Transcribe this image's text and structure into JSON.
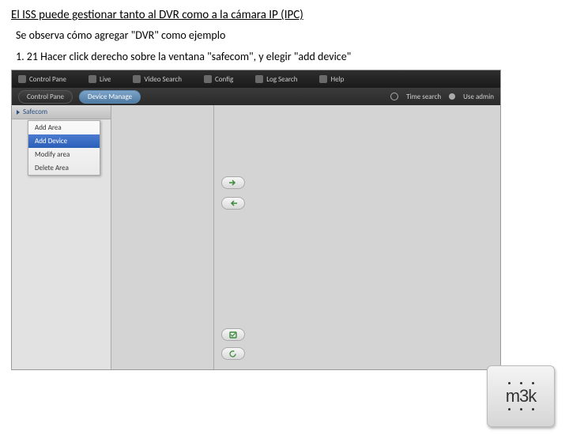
{
  "doc": {
    "title": "El ISS puede gestionar tanto al DVR como a la cámara IP (IPC)",
    "sub": "Se observa cómo agregar \"DVR\" como ejemplo",
    "step": "1. 21 Hacer click derecho sobre la ventana \"safecom\", y elegir \"add device\""
  },
  "menubar": {
    "items": [
      {
        "label": "Control Pane"
      },
      {
        "label": "Live"
      },
      {
        "label": "Video Search"
      },
      {
        "label": "Config"
      },
      {
        "label": "Log Search"
      },
      {
        "label": "Help"
      }
    ]
  },
  "submenubar": {
    "control_label": "Control Pane",
    "device_label": "Device Manage",
    "time_label": "Time search",
    "user_label": "Use admin"
  },
  "sidebar": {
    "node": "Safecom"
  },
  "context_menu": {
    "items": [
      {
        "label": "Add Area"
      },
      {
        "label": "Add Device"
      },
      {
        "label": "Modify area"
      },
      {
        "label": "Delete Area"
      }
    ],
    "highlighted_index": 1
  },
  "logo": {
    "text": "m3k"
  },
  "colors": {
    "highlight": "#2c5fb8",
    "chip_active": "#4e7aa3"
  }
}
